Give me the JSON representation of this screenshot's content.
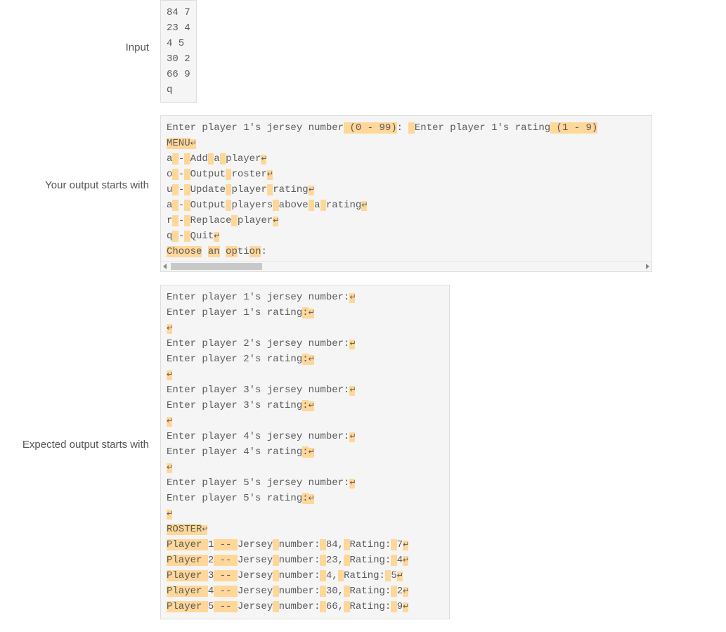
{
  "labels": {
    "input": "Input",
    "your_output": "Your output starts with",
    "expected_output": "Expected output starts with"
  },
  "input_lines": [
    "84 7",
    "23 4",
    "4 5",
    "30 2",
    "66 9",
    "q"
  ],
  "newline_glyph": "↵",
  "your_output": {
    "line1": {
      "p1": "Enter player 1's jersey number",
      "h1": " (0 - 99)",
      "p2": ": ",
      "h2a": " ",
      "p3": "Enter player 1's rating",
      "h2b": " (1 - 9)"
    },
    "l2_h": "MENU",
    "l3": {
      "a": "a",
      "sp": " ",
      "dash": "-",
      "sp2": " ",
      "t1": "Add",
      "sp3": " ",
      "t2": "a",
      "sp4": " ",
      "t3": "player"
    },
    "l4": {
      "a": "o",
      "sp": " ",
      "dash": "-",
      "sp2": " ",
      "t1": "Output",
      "sp3": " ",
      "t2": "roster"
    },
    "l5": {
      "a": "u",
      "sp": " ",
      "dash": "-",
      "sp2": " ",
      "t1": "Update",
      "sp3": " ",
      "t2": "player",
      "sp4": " ",
      "t3": "rating"
    },
    "l6": {
      "a": "a",
      "sp": " ",
      "dash": "-",
      "sp2": " ",
      "t1": "Output",
      "sp3": " ",
      "t2": "players",
      "sp4": " ",
      "t3": "above",
      "sp5": " ",
      "t4": "a",
      "sp6": " ",
      "t5": "rating"
    },
    "l7": {
      "a": "r",
      "sp": " ",
      "dash": "-",
      "sp2": " ",
      "t1": "Replace",
      "sp3": " ",
      "t2": "player"
    },
    "l8": {
      "a": "q",
      "sp": " ",
      "dash": "-",
      "sp2": " ",
      "t1": "Quit"
    },
    "l9": {
      "t1": "Choose",
      "sp": " ",
      "t2": "an",
      "sp2": " ",
      "t3": "op",
      "t4": "ti",
      "t5": "on",
      "t6": ":"
    }
  },
  "expected": {
    "jersey_lines": [
      {
        "pre": "Enter player 1's jersey number:",
        "rate": "Enter player 1's rating",
        ":": ":"
      },
      {
        "pre": "Enter player 2's jersey number:",
        "rate": "Enter player 2's rating",
        ":": ":"
      },
      {
        "pre": "Enter player 3's jersey number:",
        "rate": "Enter player 3's rating",
        ":": ":"
      },
      {
        "pre": "Enter player 4's jersey number:",
        "rate": "Enter player 4's rating",
        ":": ":"
      },
      {
        "pre": "Enter player 5's jersey number:",
        "rate": "Enter player 5's rating",
        ":": ":"
      }
    ],
    "roster_label": "ROSTER",
    "players": [
      {
        "p": "Player ",
        "n": "1",
        "dd": " -- ",
        "jl": "Jersey",
        "sp": " ",
        "nm": "number:",
        "sp2": " ",
        "jn": "84,",
        "sp3": " ",
        "rl": "Rating:",
        "sp4": " ",
        "rv": "7"
      },
      {
        "p": "Player ",
        "n": "2",
        "dd": " -- ",
        "jl": "Jersey",
        "sp": " ",
        "nm": "number:",
        "sp2": " ",
        "jn": "23,",
        "sp3": " ",
        "rl": "Rating:",
        "sp4": " ",
        "rv": "4"
      },
      {
        "p": "Player ",
        "n": "3",
        "dd": " -- ",
        "jl": "Jersey",
        "sp": " ",
        "nm": "number:",
        "sp2": " ",
        "jn": "4,",
        "sp3": " ",
        "rl": "Rating:",
        "sp4": " ",
        "rv": "5"
      },
      {
        "p": "Player ",
        "n": "4",
        "dd": " -- ",
        "jl": "Jersey",
        "sp": " ",
        "nm": "number:",
        "sp2": " ",
        "jn": "30,",
        "sp3": " ",
        "rl": "Rating:",
        "sp4": " ",
        "rv": "2"
      },
      {
        "p": "Player ",
        "n": "5",
        "dd": " -- ",
        "jl": "Jersey",
        "sp": " ",
        "nm": "number:",
        "sp2": " ",
        "jn": "66,",
        "sp3": " ",
        "rl": "Rating:",
        "sp4": " ",
        "rv": "9"
      }
    ]
  }
}
